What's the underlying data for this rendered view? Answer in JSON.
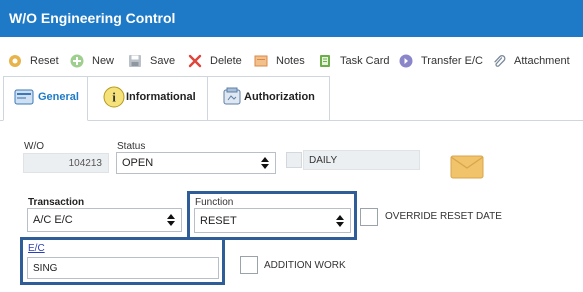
{
  "window": {
    "title": "W/O Engineering Control"
  },
  "toolbar": {
    "reset": "Reset",
    "new": "New",
    "save": "Save",
    "delete": "Delete",
    "notes": "Notes",
    "task_card": "Task Card",
    "transfer_ec": "Transfer E/C",
    "attachment": "Attachment"
  },
  "tabs": {
    "general": "General",
    "informational": "Informational",
    "authorization": "Authorization"
  },
  "form": {
    "wo_label": "W/O",
    "wo_value": "104213",
    "status_label": "Status",
    "status_value": "OPEN",
    "daily_label": "DAILY",
    "transaction_label": "Transaction",
    "transaction_value": "A/C E/C",
    "function_label": "Function",
    "function_value": "RESET",
    "override_label": "OVERRIDE RESET DATE",
    "ec_label": "E/C",
    "ec_value": "SING",
    "addition_label": "ADDITION WORK"
  },
  "colors": {
    "title_bar": "#1e7ac7",
    "highlight_border": "#2f5d98",
    "ec_label": "#2a3fb8"
  }
}
